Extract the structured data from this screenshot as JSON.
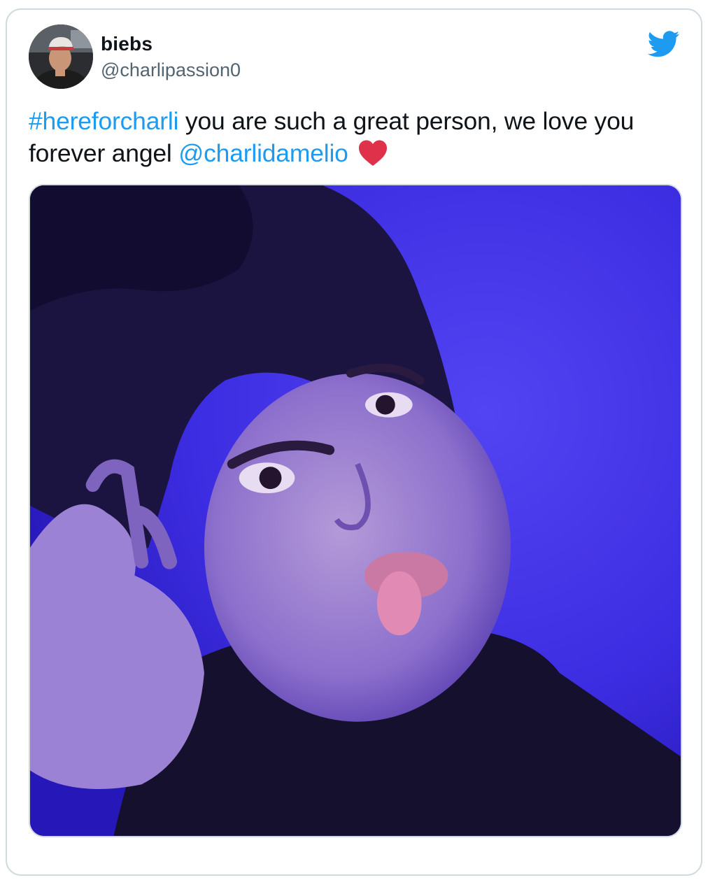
{
  "tweet": {
    "author": {
      "display_name": "biebs",
      "handle": "@charlipassion0"
    },
    "text_parts": {
      "hashtag": "#hereforcharli",
      "body": " you are such a great person, we love you forever angel ",
      "mention": "@charlidamelio"
    },
    "emoji": "heart",
    "media": {
      "type": "photo"
    }
  },
  "icons": {
    "brand": "twitter-bird-icon",
    "heart": "red-heart-icon"
  },
  "colors": {
    "link": "#1d9bf0",
    "brand": "#1d9bf0",
    "text": "#0f1419",
    "secondary": "#536471",
    "heart": "#e0314b",
    "border": "#cfd9de"
  }
}
